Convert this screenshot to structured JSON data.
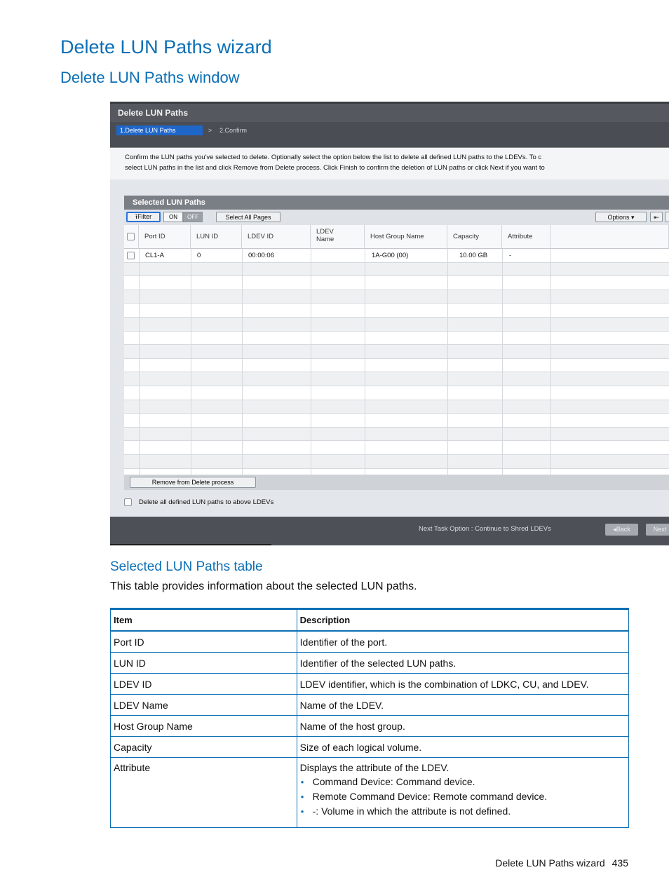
{
  "heading": "Delete LUN Paths wizard",
  "subheading": "Delete LUN Paths window",
  "window": {
    "title": "Delete LUN Paths",
    "steps": {
      "active": "1.Delete LUN Paths",
      "separator": ">",
      "next": "2.Confirm"
    },
    "description_line1": "Confirm the LUN paths you've selected to delete. Optionally select the option below the list to delete all defined LUN paths to the LDEVs. To c",
    "description_line2": "select LUN paths in the list and click Remove from Delete process. Click Finish to confirm the deletion of LUN paths or click Next if you want to",
    "panel_title": "Selected LUN Paths",
    "toolbar": {
      "filter": "⭱Filter",
      "on": "ON",
      "off": "OFF",
      "select_all": "Select All Pages",
      "options": "Options ▾"
    },
    "columns": [
      "Port ID",
      "LUN ID",
      "LDEV ID",
      "LDEV Name",
      "Host Group Name",
      "Capacity",
      "Attribute"
    ],
    "row": {
      "port_id": "CL1-A",
      "lun_id": "0",
      "ldev_id": "00:00:06",
      "ldev_name": "",
      "host_group": "1A-G00 (00)",
      "capacity": "10.00 GB",
      "attribute": "-"
    },
    "remove_button": "Remove from Delete process",
    "delete_all_label": "Delete all defined LUN paths to above LDEVs",
    "next_task": "Next Task Option : Continue to Shred LDEVs",
    "back_button": "◂Back",
    "next_button": "Next"
  },
  "section_title": "Selected LUN Paths table",
  "intro": "This table provides information about the selected LUN paths.",
  "table": {
    "header_item": "Item",
    "header_desc": "Description",
    "rows": [
      {
        "item": "Port ID",
        "desc": "Identifier of the port."
      },
      {
        "item": "LUN ID",
        "desc": "Identifier of the selected LUN paths."
      },
      {
        "item": "LDEV ID",
        "desc": "LDEV identifier, which is the combination of LDKC, CU, and LDEV."
      },
      {
        "item": "LDEV Name",
        "desc": "Name of the LDEV."
      },
      {
        "item": "Host Group Name",
        "desc": "Name of the host group."
      },
      {
        "item": "Capacity",
        "desc": "Size of each logical volume."
      },
      {
        "item": "Attribute",
        "desc": "Displays the attribute of the LDEV."
      }
    ],
    "attribute_bullets": [
      "Command Device: Command device.",
      "Remote Command Device: Remote command device.",
      "-: Volume in which the attribute is not defined."
    ]
  },
  "footer": {
    "text": "Delete LUN Paths wizard",
    "page": "435"
  }
}
